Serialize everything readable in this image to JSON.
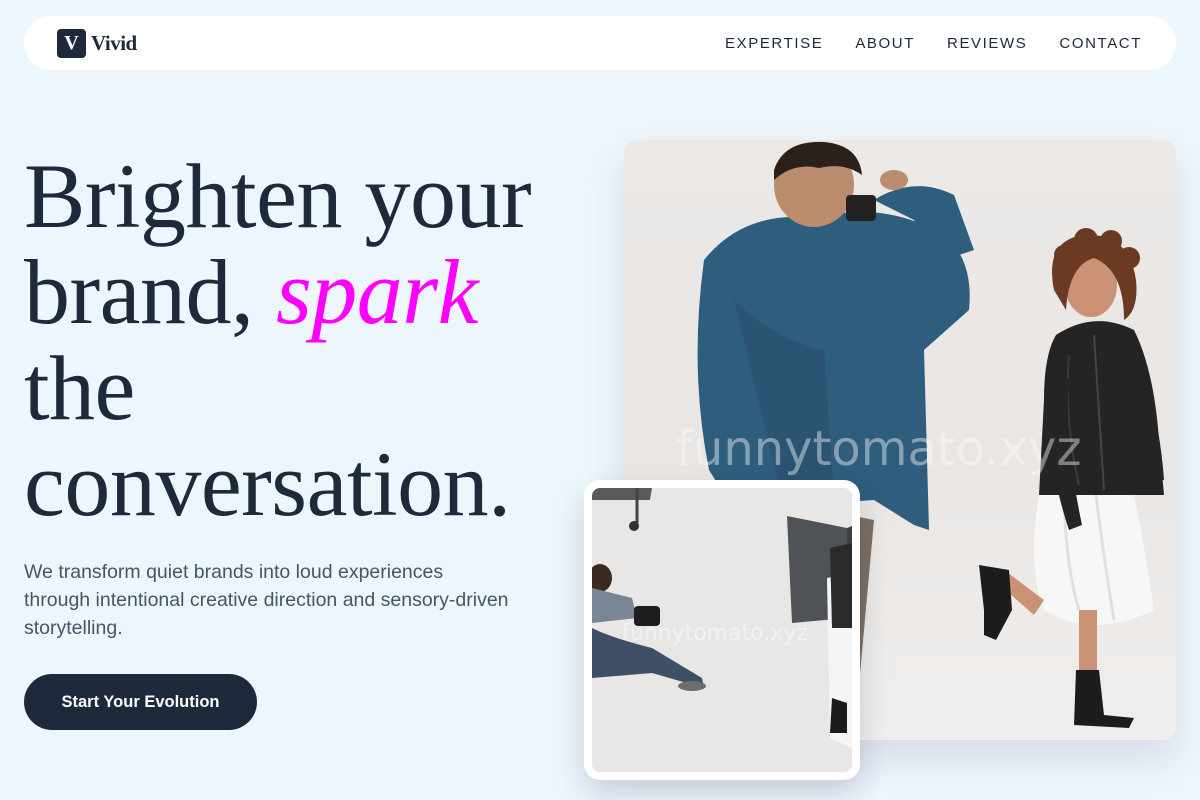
{
  "brand": {
    "mark": "V",
    "name": "Vivid"
  },
  "nav": {
    "links": [
      "EXPERTISE",
      "ABOUT",
      "REVIEWS",
      "CONTACT"
    ]
  },
  "hero": {
    "headline_part1": "Brighten your brand, ",
    "headline_accent": "spark",
    "headline_part2": " the conversation.",
    "subtext": "We transform quiet brands into loud experiences through intentional creative direction and sensory-driven storytelling.",
    "cta_label": "Start Your Evolution"
  },
  "images": {
    "main_watermark": "funnytomato.xyz",
    "small_watermark": "funnytomato.xyz"
  },
  "colors": {
    "background": "#eef6fd",
    "primary": "#1e293b",
    "accent": "#ff00ff"
  }
}
